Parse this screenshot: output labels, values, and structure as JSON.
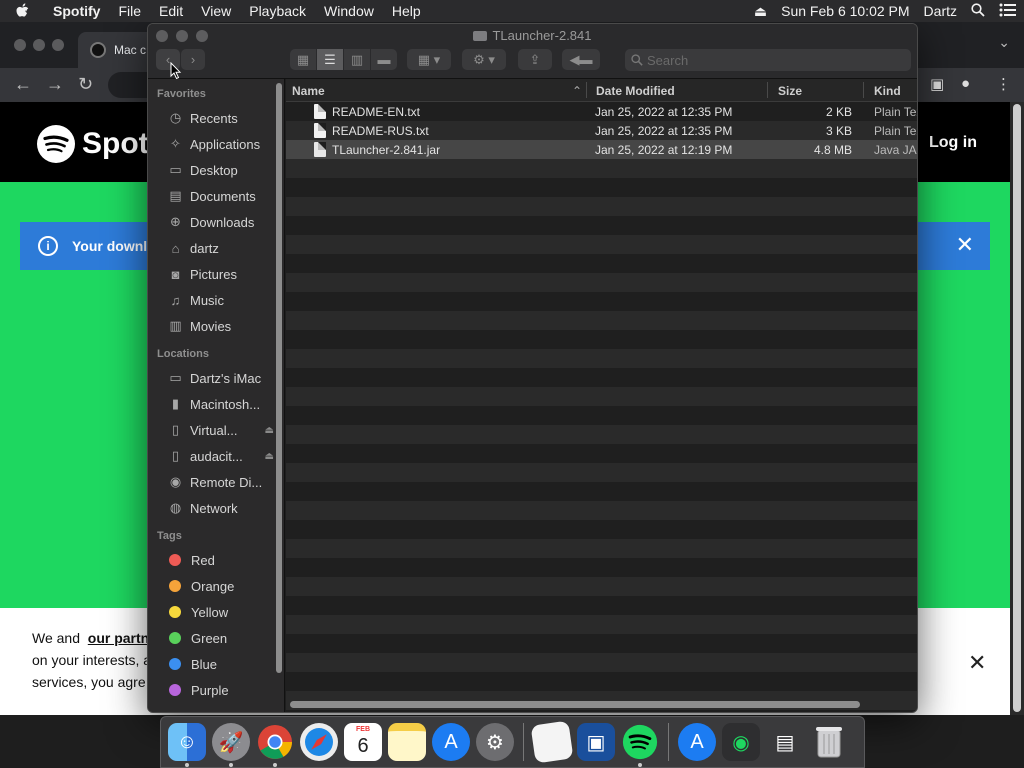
{
  "menubar": {
    "app_name": "Spotify",
    "items": [
      "File",
      "Edit",
      "View",
      "Playback",
      "Window",
      "Help"
    ],
    "date_time": "Sun Feb 6  10:02 PM",
    "user": "Dartz"
  },
  "browser": {
    "tab_title": "Mac c",
    "page": {
      "logo_text": "Spotif",
      "login_label": "Log in",
      "banner_text": "Your downl",
      "cookie_line1_prefix": "We and",
      "cookie_line1_link": "our partn",
      "cookie_line2": "on your interests, a",
      "cookie_line3": "services, you agre"
    }
  },
  "finder": {
    "title": "TLauncher-2.841",
    "search_placeholder": "Search",
    "sidebar": {
      "favorites_label": "Favorites",
      "favorites": [
        {
          "label": "Recents",
          "icon": "clock-icon"
        },
        {
          "label": "Applications",
          "icon": "applications-icon"
        },
        {
          "label": "Desktop",
          "icon": "desktop-icon"
        },
        {
          "label": "Documents",
          "icon": "document-icon"
        },
        {
          "label": "Downloads",
          "icon": "download-icon"
        },
        {
          "label": "dartz",
          "icon": "home-icon"
        },
        {
          "label": "Pictures",
          "icon": "camera-icon"
        },
        {
          "label": "Music",
          "icon": "music-note-icon"
        },
        {
          "label": "Movies",
          "icon": "film-icon"
        }
      ],
      "locations_label": "Locations",
      "locations": [
        {
          "label": "Dartz's iMac",
          "icon": "imac-icon",
          "eject": false
        },
        {
          "label": "Macintosh...",
          "icon": "hard-drive-icon",
          "eject": false
        },
        {
          "label": "Virtual...",
          "icon": "disk-icon",
          "eject": true
        },
        {
          "label": "audacit...",
          "icon": "disk-icon",
          "eject": true
        },
        {
          "label": "Remote Di...",
          "icon": "remote-disc-icon",
          "eject": false
        },
        {
          "label": "Network",
          "icon": "network-globe-icon",
          "eject": false
        }
      ],
      "tags_label": "Tags",
      "tags": [
        {
          "label": "Red",
          "color": "#ee5b55"
        },
        {
          "label": "Orange",
          "color": "#f5a33a"
        },
        {
          "label": "Yellow",
          "color": "#f6d83c"
        },
        {
          "label": "Green",
          "color": "#59d15b"
        },
        {
          "label": "Blue",
          "color": "#3b8ff0"
        },
        {
          "label": "Purple",
          "color": "#b865dc"
        }
      ]
    },
    "columns": {
      "name": "Name",
      "date": "Date Modified",
      "size": "Size",
      "kind": "Kind"
    },
    "files": [
      {
        "name": "README-EN.txt",
        "date": "Jan 25, 2022 at 12:35 PM",
        "size": "2 KB",
        "kind": "Plain Tex",
        "selected": false
      },
      {
        "name": "README-RUS.txt",
        "date": "Jan 25, 2022 at 12:35 PM",
        "size": "3 KB",
        "kind": "Plain Tex",
        "selected": false
      },
      {
        "name": "TLauncher-2.841.jar",
        "date": "Jan 25, 2022 at 12:19 PM",
        "size": "4.8 MB",
        "kind": "Java JAI",
        "selected": true
      }
    ]
  },
  "dock": {
    "calendar_month": "FEB",
    "calendar_day": "6",
    "apps": [
      "finder",
      "launchpad",
      "chrome",
      "safari",
      "calendar",
      "notes",
      "app-store",
      "system-preferences",
      "textedit",
      "virtualbox",
      "spotify",
      "app-store-2",
      "spotify-installer",
      "folder",
      "trash"
    ]
  }
}
